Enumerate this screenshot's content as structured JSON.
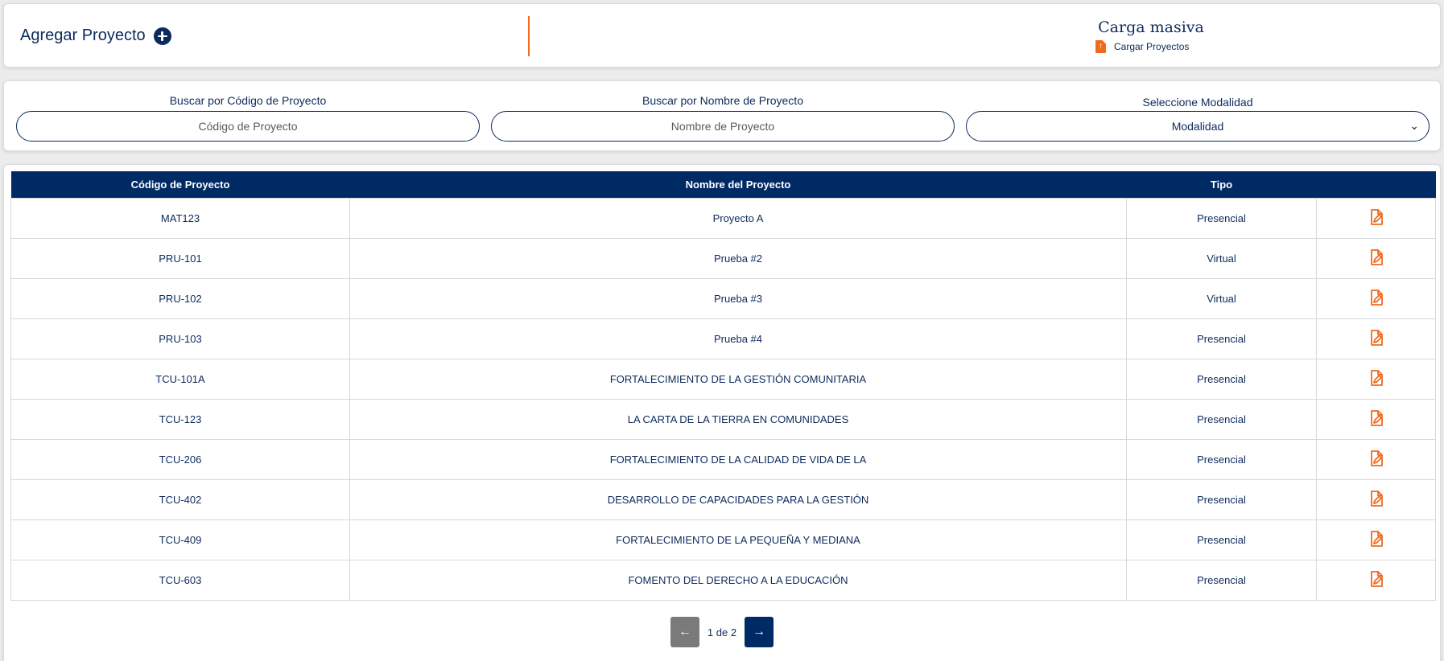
{
  "header": {
    "add_label": "Agregar Proyecto",
    "bulk_title": "Carga masiva",
    "bulk_link": "Cargar Proyectos"
  },
  "search": {
    "code_label": "Buscar por Código de Proyecto",
    "code_placeholder": "Código de Proyecto",
    "name_label": "Buscar por Nombre de Proyecto",
    "name_placeholder": "Nombre de Proyecto",
    "modality_label": "Seleccione Modalidad",
    "modality_value": "Modalidad"
  },
  "table": {
    "headers": [
      "Código de Proyecto",
      "Nombre del Proyecto",
      "Tipo",
      ""
    ],
    "rows": [
      {
        "code": "MAT123",
        "name": "Proyecto A",
        "type": "Presencial"
      },
      {
        "code": "PRU-101",
        "name": "Prueba #2",
        "type": "Virtual"
      },
      {
        "code": "PRU-102",
        "name": "Prueba #3",
        "type": "Virtual"
      },
      {
        "code": "PRU-103",
        "name": "Prueba #4",
        "type": "Presencial"
      },
      {
        "code": "TCU-101A",
        "name": "FORTALECIMIENTO DE LA GESTIÓN COMUNITARIA",
        "type": "Presencial"
      },
      {
        "code": "TCU-123",
        "name": "LA CARTA DE LA TIERRA EN COMUNIDADES",
        "type": "Presencial"
      },
      {
        "code": "TCU-206",
        "name": "FORTALECIMIENTO DE LA CALIDAD DE VIDA DE LA",
        "type": "Presencial"
      },
      {
        "code": "TCU-402",
        "name": "DESARROLLO DE CAPACIDADES PARA LA GESTIÓN",
        "type": "Presencial"
      },
      {
        "code": "TCU-409",
        "name": "FORTALECIMIENTO DE LA PEQUEÑA Y MEDIANA",
        "type": "Presencial"
      },
      {
        "code": "TCU-603",
        "name": "FOMENTO DEL DERECHO A LA EDUCACIÓN",
        "type": "Presencial"
      }
    ]
  },
  "pagination": {
    "text": "1 de 2",
    "prev_icon": "arrow-left-icon",
    "next_icon": "arrow-right-icon"
  },
  "colors": {
    "primary": "#002a63",
    "accent": "#f06a1e",
    "disabled": "#7a7a7a"
  },
  "icons": {
    "add": "plus-circle-icon",
    "upload": "file-upload-icon",
    "edit": "file-edit-icon"
  }
}
